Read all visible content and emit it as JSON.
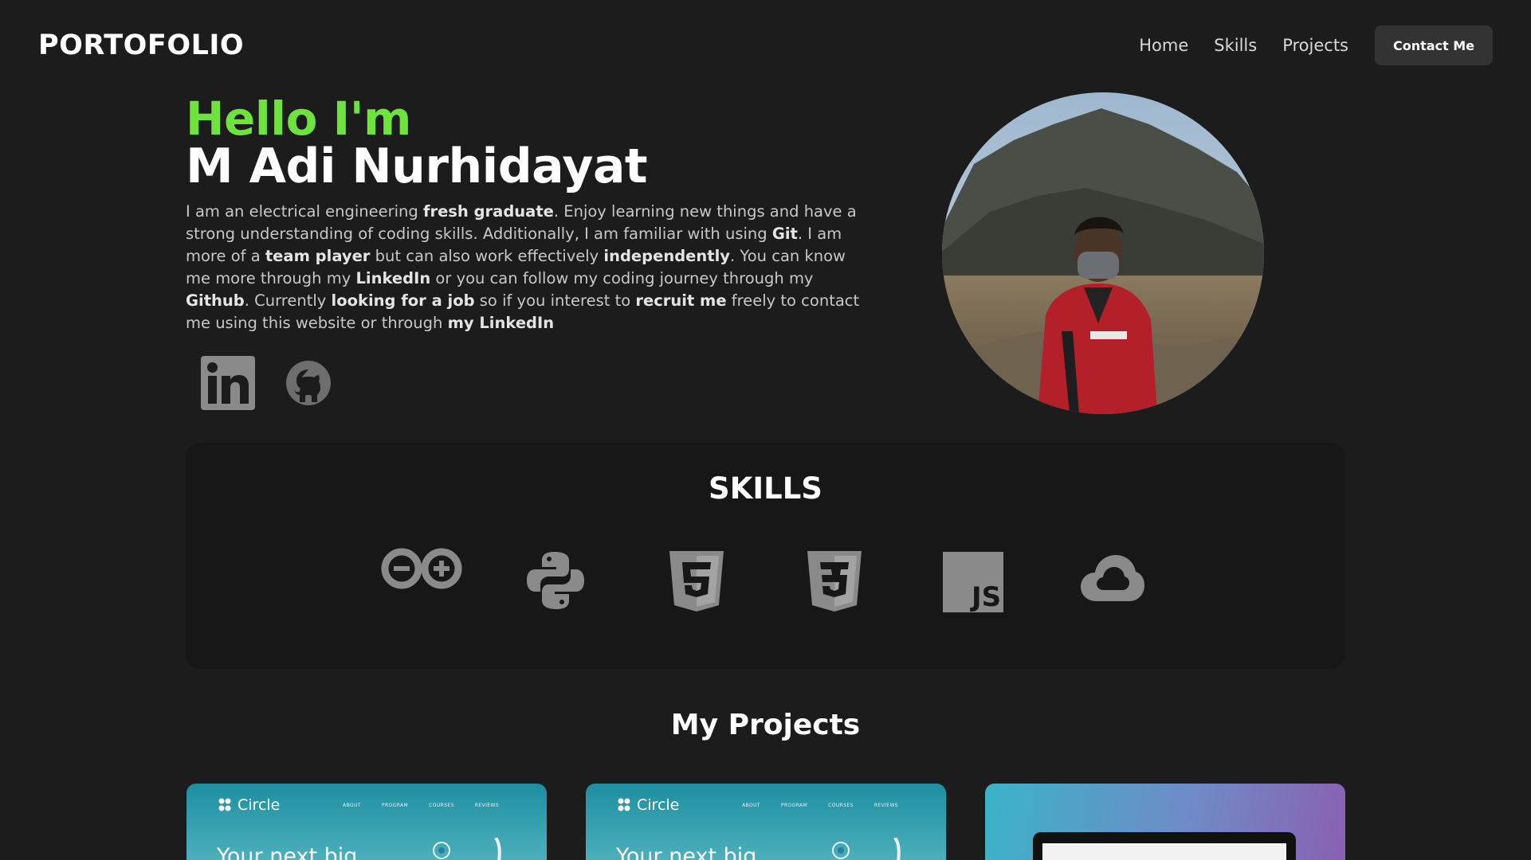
{
  "nav": {
    "brand": "PORTOFOLIO",
    "links": [
      "Home",
      "Skills",
      "Projects"
    ],
    "cta": "Contact Me"
  },
  "hero": {
    "greeting": "Hello I'm",
    "name": "M Adi Nurhidayat",
    "bio": [
      {
        "t": "I am an electrical engineering ",
        "b": false
      },
      {
        "t": "fresh graduate",
        "b": true
      },
      {
        "t": ". Enjoy learning new things and have a strong understanding of coding skills. Additionally, I am familiar with using ",
        "b": false
      },
      {
        "t": "Git",
        "b": true
      },
      {
        "t": ". I am more of a ",
        "b": false
      },
      {
        "t": "team player",
        "b": true
      },
      {
        "t": " but can also work effectively ",
        "b": false
      },
      {
        "t": "independently",
        "b": true
      },
      {
        "t": ". You can know me more through my ",
        "b": false
      },
      {
        "t": "LinkedIn",
        "b": true
      },
      {
        "t": " or you can follow my coding journey through my ",
        "b": false
      },
      {
        "t": "Github",
        "b": true
      },
      {
        "t": ". Currently ",
        "b": false
      },
      {
        "t": "looking for a job",
        "b": true
      },
      {
        "t": " so if you interest to ",
        "b": false
      },
      {
        "t": "recruit me",
        "b": true
      },
      {
        "t": " freely to contact me using this website or through ",
        "b": false
      },
      {
        "t": "my LinkedIn",
        "b": true
      }
    ],
    "social_icons": [
      "linkedin-icon",
      "github-icon"
    ]
  },
  "skills": {
    "title": "SKILLS",
    "icons": [
      "arduino-icon",
      "python-icon",
      "html5-icon",
      "css3-icon",
      "javascript-icon",
      "google-cloud-icon"
    ]
  },
  "projects": {
    "title": "My Projects",
    "cards": [
      {
        "logo": "Circle",
        "menu": [
          "ABOUT",
          "PROGRAM",
          "COURSES",
          "REVIEWS"
        ],
        "headline": "Your next big"
      },
      {
        "logo": "Circle",
        "menu": [
          "ABOUT",
          "PROGRAM",
          "COURSES",
          "REVIEWS"
        ],
        "headline": "Your next big"
      },
      {
        "logo": "",
        "menu": [],
        "headline": ""
      }
    ]
  },
  "colors": {
    "background": "#1c1c1c",
    "accent_green": "#6fe33d",
    "panel": "#171717",
    "button": "#333333",
    "icon_gray": "#8a8a8a"
  }
}
